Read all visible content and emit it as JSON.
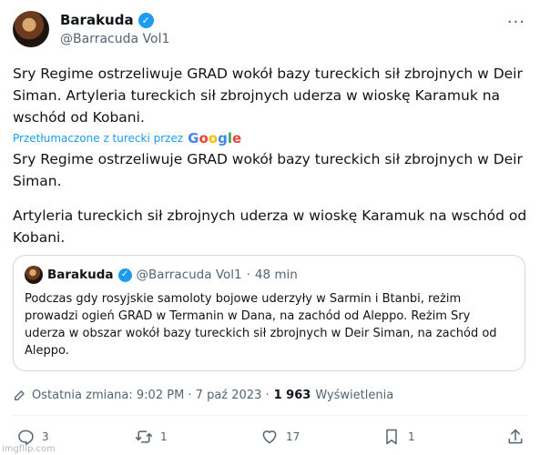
{
  "author": {
    "name": "Barakuda",
    "handle": "@Barracuda Vol1"
  },
  "more_icon": "more-horizontal-icon",
  "original_text": "Sry Regime ostrzeliwuje GRAD wokół bazy tureckich sił zbrojnych w Deir Siman. Artyleria tureckich sił zbrojnych uderza w wioskę Karamuk na wschód od Kobani.",
  "translation": {
    "label": "Przetłumaczone z turecki przez",
    "provider": [
      "G",
      "o",
      "o",
      "g",
      "l",
      "e"
    ],
    "paragraph1": "Sry Regime ostrzeliwuje GRAD wokół bazy tureckich sił zbrojnych w Deir Siman.",
    "paragraph2": "Artyleria tureckich sił zbrojnych uderza w wioskę Karamuk na wschód od Kobani."
  },
  "quoted": {
    "name": "Barakuda",
    "handle": "@Barracuda Vol1",
    "separator": "·",
    "time": "48 min",
    "text": "Podczas gdy rosyjskie samoloty bojowe uderzyły w Sarmin i Btanbi, reżim prowadzi ogień GRAD w Termanin w Dana, na zachód od Aleppo. Reżim Sry uderza w obszar wokół bazy tureckich sił zbrojnych w Deir Siman, na zachód od Aleppo."
  },
  "edit_info": {
    "label": "Ostatnia zmiana: 9:02 PM · 7 paź 2023 ·",
    "views_count": "1 963",
    "views_label": "Wyświetlenia"
  },
  "actions": {
    "reply_count": "3",
    "retweet_count": "1",
    "like_count": "17",
    "bookmark_count": "1"
  },
  "watermark": "imgflip.com",
  "colors": {
    "accent": "#1d9bf0",
    "text": "#0f1419",
    "muted": "#536471",
    "border": "#cfd9de"
  }
}
